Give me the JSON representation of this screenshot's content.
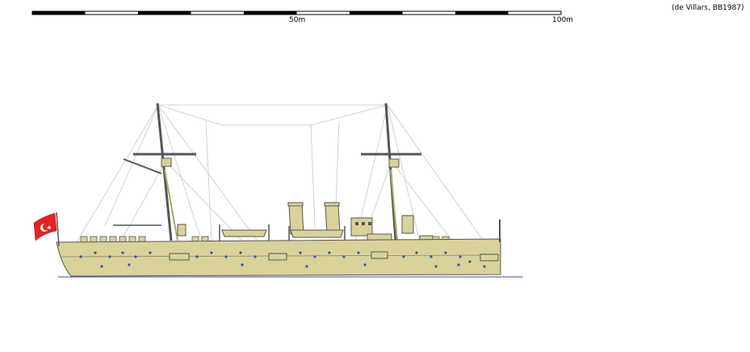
{
  "credit": "(de Villars, BB1987)",
  "scale_bar": {
    "label_mid": "50m",
    "label_end": "100m",
    "unit": "m",
    "length": 100,
    "segments": 10
  },
  "ship": {
    "hull_color": "#d9d29a",
    "outline_color": "#555555",
    "porthole_color": "#3a55a8",
    "rigging_color": "#c8c8b8",
    "waterline_color": "#3a4fa0",
    "ensign": {
      "field_color": "#e32323",
      "emblem_color": "#ffffff",
      "emblem": "crescent-and-star"
    },
    "funnels": 2,
    "masts": 2
  }
}
